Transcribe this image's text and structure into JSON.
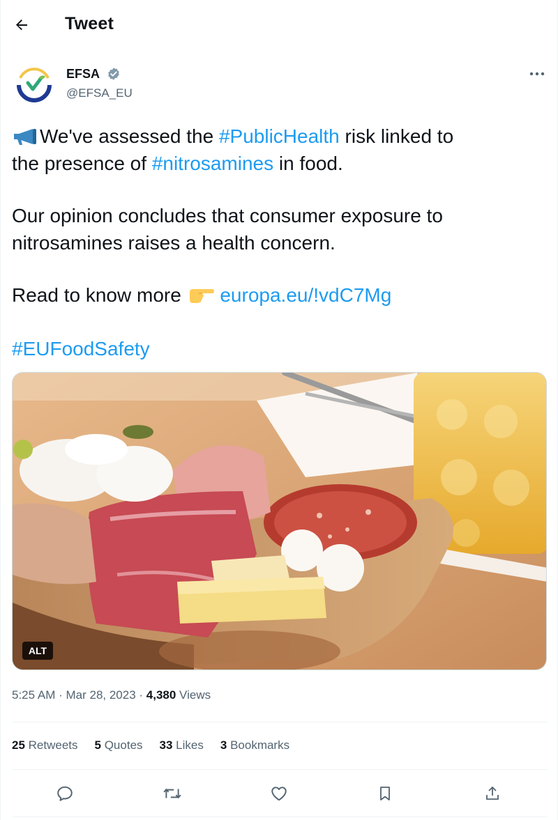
{
  "header": {
    "title": "Tweet",
    "back_icon": "arrow-left-icon"
  },
  "author": {
    "name": "EFSA",
    "handle": "@EFSA_EU",
    "verified": true,
    "avatar_icon": "efsa-logo-icon"
  },
  "tweet": {
    "line1_emoji": "megaphone-icon",
    "line1_pre": "We've assessed the ",
    "hashtag_public_health": "#PublicHealth",
    "line1_post": " risk linked to",
    "line2_pre": "the presence of ",
    "hashtag_nitrosamines": "#nitrosamines",
    "line2_post": " in food.",
    "paragraph2": "Our opinion concludes that consumer exposure to nitrosamines raises a health concern.",
    "read_more": "Read to know more ",
    "pointing_emoji": "pointing-right-icon",
    "link": "europa.eu/!vdC7Mg",
    "hashtag_eu_food_safety": "#EUFoodSafety"
  },
  "media": {
    "alt_badge": "ALT",
    "description_icon": "charcuterie-photo"
  },
  "meta": {
    "time": "5:25 AM",
    "separator": " · ",
    "date": "Mar 28, 2023",
    "views_count": "4,380",
    "views_label": " Views"
  },
  "stats": {
    "retweets_count": "25",
    "retweets_label": " Retweets",
    "quotes_count": "5",
    "quotes_label": " Quotes",
    "likes_count": "33",
    "likes_label": " Likes",
    "bookmarks_count": "3",
    "bookmarks_label": " Bookmarks"
  },
  "actions": [
    "reply-icon",
    "retweet-icon",
    "like-icon",
    "bookmark-icon",
    "share-icon"
  ],
  "colors": {
    "link": "#1d9bf0",
    "text": "#0f1419",
    "secondary": "#536471",
    "border": "#eff3f4"
  }
}
